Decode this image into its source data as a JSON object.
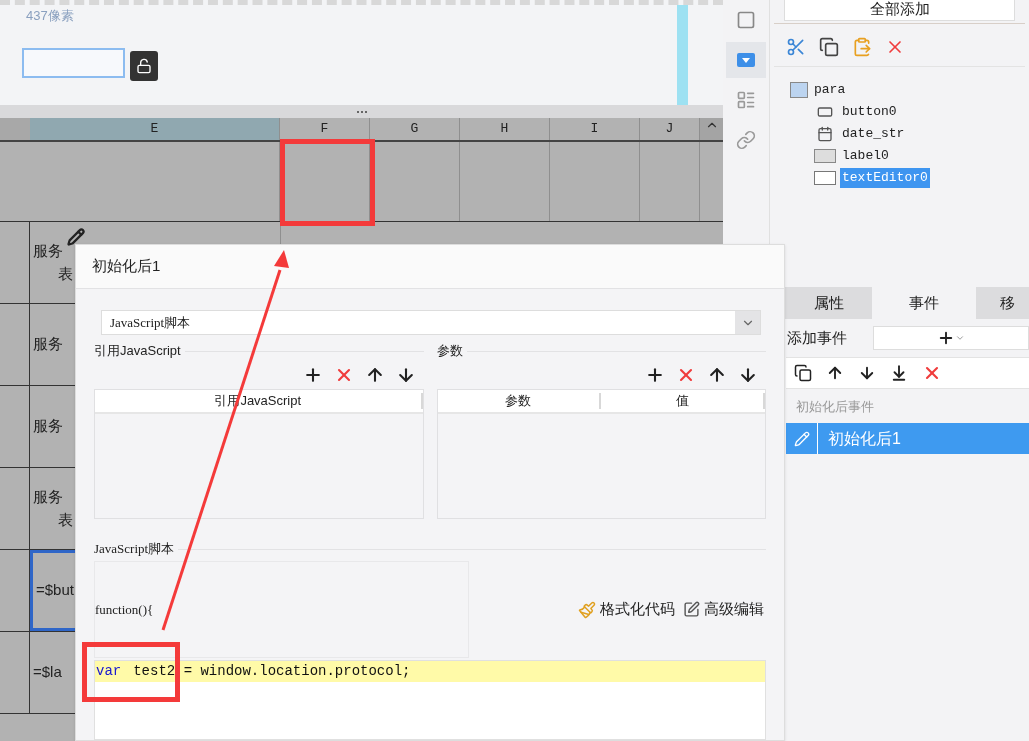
{
  "canvas": {
    "size_label": "437像素"
  },
  "grid": {
    "columns": [
      {
        "label": "E",
        "selected": true
      },
      {
        "label": "F",
        "selected": false
      },
      {
        "label": "G",
        "selected": false
      },
      {
        "label": "H",
        "selected": false
      },
      {
        "label": "I",
        "selected": false
      },
      {
        "label": "J",
        "selected": false
      }
    ],
    "rows": [
      {
        "lines": [
          "服务",
          "表"
        ],
        "selected": false
      },
      {
        "lines": [
          "服务"
        ],
        "selected": false
      },
      {
        "lines": [
          "服务"
        ],
        "selected": false
      },
      {
        "lines": [
          "服务",
          "表"
        ],
        "selected": false
      },
      {
        "lines": [
          "=$but"
        ],
        "selected": true
      },
      {
        "lines": [
          "=$la"
        ],
        "selected": false
      }
    ]
  },
  "dialog": {
    "title": "初始化后1",
    "type_select": {
      "value": "JavaScript脚本"
    },
    "ref_section": {
      "title": "引用JavaScript",
      "columns": [
        "引用JavaScript"
      ]
    },
    "param_section": {
      "title": "参数",
      "columns": [
        "参数",
        "值"
      ]
    },
    "script_section": {
      "title": "JavaScript脚本",
      "header_code": "function(){",
      "actions": [
        {
          "kind": "format",
          "label": "格式化代码"
        },
        {
          "kind": "edit",
          "label": "高级编辑"
        }
      ],
      "code_lines": [
        {
          "highlighted": true,
          "tokens": [
            {
              "kind": "keyword",
              "text": "var"
            },
            {
              "kind": "plain",
              "text": "test2 = window.location.protocol;"
            }
          ]
        }
      ]
    }
  },
  "side_tools": [
    {
      "kind": "frame",
      "selected": false
    },
    {
      "kind": "dropdown",
      "selected": true
    },
    {
      "kind": "layout",
      "selected": false
    },
    {
      "kind": "link",
      "selected": false
    }
  ],
  "right_panel": {
    "add_all": "全部添加",
    "tree": {
      "label": "para",
      "children": [
        {
          "kind": "button",
          "label": "button0",
          "selected": false
        },
        {
          "kind": "date",
          "label": "date_str",
          "selected": false
        },
        {
          "kind": "label",
          "label": "label0",
          "selected": false
        },
        {
          "kind": "editor",
          "label": "textEditor0",
          "selected": true
        }
      ]
    },
    "tabs": [
      {
        "label": "属性",
        "selected": false
      },
      {
        "label": "事件",
        "selected": true
      },
      {
        "label": "移",
        "selected": false
      }
    ],
    "add_event_label": "添加事件",
    "event_group": "初始化后事件",
    "events": [
      {
        "label": "初始化后1",
        "selected": true
      }
    ]
  }
}
